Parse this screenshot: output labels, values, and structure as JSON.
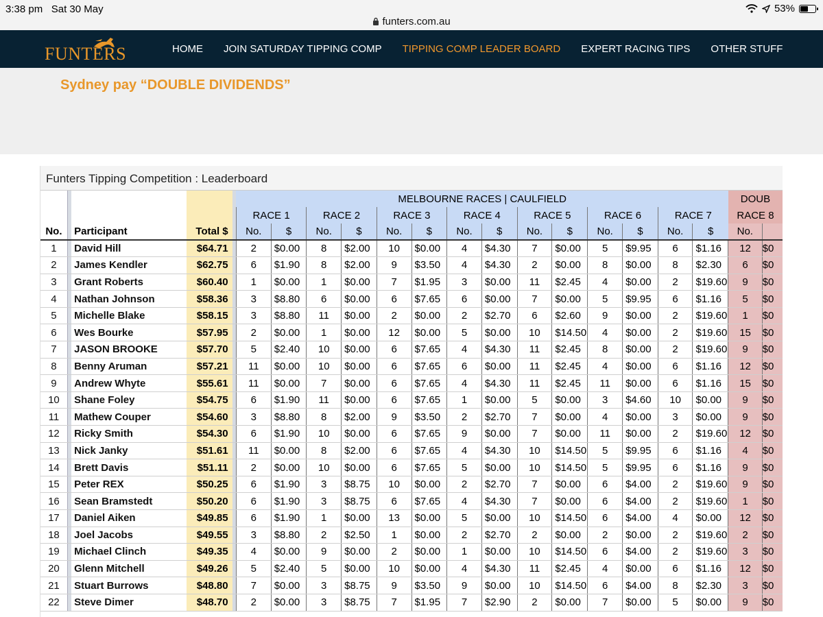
{
  "status": {
    "time": "3:38 pm",
    "date": "Sat 30 May",
    "url": "funters.com.au",
    "battery": "53%"
  },
  "nav": {
    "logo_text": "FUNTERS",
    "items": [
      {
        "label": "HOME",
        "active": false
      },
      {
        "label": "JOIN SATURDAY TIPPING COMP",
        "active": false
      },
      {
        "label": "TIPPING COMP LEADER BOARD",
        "active": true
      },
      {
        "label": "EXPERT RACING TIPS",
        "active": false
      },
      {
        "label": "OTHER STUFF",
        "active": false
      }
    ]
  },
  "banner": {
    "title": "Sydney pay “DOUBLE DIVIDENDS”"
  },
  "leaderboard": {
    "title": "Funters Tipping Competition : Leaderboard",
    "group_melbourne": "MELBOURNE RACES | CAULFIELD",
    "group_double": "DOUB",
    "races": [
      "RACE 1",
      "RACE 2",
      "RACE 3",
      "RACE 4",
      "RACE 5",
      "RACE 6",
      "RACE 7",
      "RACE 8"
    ],
    "col_no": "No.",
    "col_participant": "Participant",
    "col_total": "Total $",
    "sub_no": "No.",
    "sub_amt": "$",
    "rows": [
      {
        "rank": "1",
        "name": "David Hill",
        "total": "$64.71",
        "picks": [
          [
            "2",
            "$0.00"
          ],
          [
            "8",
            "$2.00"
          ],
          [
            "10",
            "$0.00"
          ],
          [
            "4",
            "$4.30"
          ],
          [
            "7",
            "$0.00"
          ],
          [
            "5",
            "$9.95"
          ],
          [
            "6",
            "$1.16"
          ]
        ],
        "d_no": "12",
        "d_amt": "$0"
      },
      {
        "rank": "2",
        "name": "James Kendler",
        "total": "$62.75",
        "picks": [
          [
            "6",
            "$1.90"
          ],
          [
            "8",
            "$2.00"
          ],
          [
            "9",
            "$3.50"
          ],
          [
            "4",
            "$4.30"
          ],
          [
            "2",
            "$0.00"
          ],
          [
            "8",
            "$0.00"
          ],
          [
            "8",
            "$2.30"
          ]
        ],
        "d_no": "6",
        "d_amt": "$0"
      },
      {
        "rank": "3",
        "name": "Grant Roberts",
        "total": "$60.40",
        "picks": [
          [
            "1",
            "$0.00"
          ],
          [
            "1",
            "$0.00"
          ],
          [
            "7",
            "$1.95"
          ],
          [
            "3",
            "$0.00"
          ],
          [
            "11",
            "$2.45"
          ],
          [
            "4",
            "$0.00"
          ],
          [
            "2",
            "$19.60"
          ]
        ],
        "d_no": "9",
        "d_amt": "$0"
      },
      {
        "rank": "4",
        "name": "Nathan Johnson",
        "total": "$58.36",
        "picks": [
          [
            "3",
            "$8.80"
          ],
          [
            "6",
            "$0.00"
          ],
          [
            "6",
            "$7.65"
          ],
          [
            "6",
            "$0.00"
          ],
          [
            "7",
            "$0.00"
          ],
          [
            "5",
            "$9.95"
          ],
          [
            "6",
            "$1.16"
          ]
        ],
        "d_no": "5",
        "d_amt": "$0"
      },
      {
        "rank": "5",
        "name": "Michelle Blake",
        "total": "$58.15",
        "picks": [
          [
            "3",
            "$8.80"
          ],
          [
            "11",
            "$0.00"
          ],
          [
            "2",
            "$0.00"
          ],
          [
            "2",
            "$2.70"
          ],
          [
            "6",
            "$2.60"
          ],
          [
            "9",
            "$0.00"
          ],
          [
            "2",
            "$19.60"
          ]
        ],
        "d_no": "1",
        "d_amt": "$0"
      },
      {
        "rank": "6",
        "name": "Wes Bourke",
        "total": "$57.95",
        "picks": [
          [
            "2",
            "$0.00"
          ],
          [
            "1",
            "$0.00"
          ],
          [
            "12",
            "$0.00"
          ],
          [
            "5",
            "$0.00"
          ],
          [
            "10",
            "$14.50"
          ],
          [
            "4",
            "$0.00"
          ],
          [
            "2",
            "$19.60"
          ]
        ],
        "d_no": "15",
        "d_amt": "$0"
      },
      {
        "rank": "7",
        "name": "JASON BROOKE",
        "total": "$57.70",
        "picks": [
          [
            "5",
            "$2.40"
          ],
          [
            "10",
            "$0.00"
          ],
          [
            "6",
            "$7.65"
          ],
          [
            "4",
            "$4.30"
          ],
          [
            "11",
            "$2.45"
          ],
          [
            "8",
            "$0.00"
          ],
          [
            "2",
            "$19.60"
          ]
        ],
        "d_no": "9",
        "d_amt": "$0"
      },
      {
        "rank": "8",
        "name": "Benny Aruman",
        "total": "$57.21",
        "picks": [
          [
            "11",
            "$0.00"
          ],
          [
            "10",
            "$0.00"
          ],
          [
            "6",
            "$7.65"
          ],
          [
            "6",
            "$0.00"
          ],
          [
            "11",
            "$2.45"
          ],
          [
            "4",
            "$0.00"
          ],
          [
            "6",
            "$1.16"
          ]
        ],
        "d_no": "12",
        "d_amt": "$0"
      },
      {
        "rank": "9",
        "name": "Andrew Whyte",
        "total": "$55.61",
        "picks": [
          [
            "11",
            "$0.00"
          ],
          [
            "7",
            "$0.00"
          ],
          [
            "6",
            "$7.65"
          ],
          [
            "4",
            "$4.30"
          ],
          [
            "11",
            "$2.45"
          ],
          [
            "11",
            "$0.00"
          ],
          [
            "6",
            "$1.16"
          ]
        ],
        "d_no": "15",
        "d_amt": "$0"
      },
      {
        "rank": "10",
        "name": "Shane Foley",
        "total": "$54.75",
        "picks": [
          [
            "6",
            "$1.90"
          ],
          [
            "11",
            "$0.00"
          ],
          [
            "6",
            "$7.65"
          ],
          [
            "1",
            "$0.00"
          ],
          [
            "5",
            "$0.00"
          ],
          [
            "3",
            "$4.60"
          ],
          [
            "10",
            "$0.00"
          ]
        ],
        "d_no": "9",
        "d_amt": "$0"
      },
      {
        "rank": "11",
        "name": "Mathew Couper",
        "total": "$54.60",
        "picks": [
          [
            "3",
            "$8.80"
          ],
          [
            "8",
            "$2.00"
          ],
          [
            "9",
            "$3.50"
          ],
          [
            "2",
            "$2.70"
          ],
          [
            "7",
            "$0.00"
          ],
          [
            "4",
            "$0.00"
          ],
          [
            "3",
            "$0.00"
          ]
        ],
        "d_no": "9",
        "d_amt": "$0"
      },
      {
        "rank": "12",
        "name": "Ricky Smith",
        "total": "$54.30",
        "picks": [
          [
            "6",
            "$1.90"
          ],
          [
            "10",
            "$0.00"
          ],
          [
            "6",
            "$7.65"
          ],
          [
            "9",
            "$0.00"
          ],
          [
            "7",
            "$0.00"
          ],
          [
            "11",
            "$0.00"
          ],
          [
            "2",
            "$19.60"
          ]
        ],
        "d_no": "12",
        "d_amt": "$0"
      },
      {
        "rank": "13",
        "name": "Nick Janky",
        "total": "$51.61",
        "picks": [
          [
            "11",
            "$0.00"
          ],
          [
            "8",
            "$2.00"
          ],
          [
            "6",
            "$7.65"
          ],
          [
            "4",
            "$4.30"
          ],
          [
            "10",
            "$14.50"
          ],
          [
            "5",
            "$9.95"
          ],
          [
            "6",
            "$1.16"
          ]
        ],
        "d_no": "4",
        "d_amt": "$0"
      },
      {
        "rank": "14",
        "name": "Brett Davis",
        "total": "$51.11",
        "picks": [
          [
            "2",
            "$0.00"
          ],
          [
            "10",
            "$0.00"
          ],
          [
            "6",
            "$7.65"
          ],
          [
            "5",
            "$0.00"
          ],
          [
            "10",
            "$14.50"
          ],
          [
            "5",
            "$9.95"
          ],
          [
            "6",
            "$1.16"
          ]
        ],
        "d_no": "9",
        "d_amt": "$0"
      },
      {
        "rank": "15",
        "name": "Peter REX",
        "total": "$50.25",
        "picks": [
          [
            "6",
            "$1.90"
          ],
          [
            "3",
            "$8.75"
          ],
          [
            "10",
            "$0.00"
          ],
          [
            "2",
            "$2.70"
          ],
          [
            "7",
            "$0.00"
          ],
          [
            "6",
            "$4.00"
          ],
          [
            "2",
            "$19.60"
          ]
        ],
        "d_no": "9",
        "d_amt": "$0"
      },
      {
        "rank": "16",
        "name": "Sean Bramstedt",
        "total": "$50.20",
        "picks": [
          [
            "6",
            "$1.90"
          ],
          [
            "3",
            "$8.75"
          ],
          [
            "6",
            "$7.65"
          ],
          [
            "4",
            "$4.30"
          ],
          [
            "7",
            "$0.00"
          ],
          [
            "6",
            "$4.00"
          ],
          [
            "2",
            "$19.60"
          ]
        ],
        "d_no": "1",
        "d_amt": "$0"
      },
      {
        "rank": "17",
        "name": "Daniel Aiken",
        "total": "$49.85",
        "picks": [
          [
            "6",
            "$1.90"
          ],
          [
            "1",
            "$0.00"
          ],
          [
            "13",
            "$0.00"
          ],
          [
            "5",
            "$0.00"
          ],
          [
            "10",
            "$14.50"
          ],
          [
            "6",
            "$4.00"
          ],
          [
            "4",
            "$0.00"
          ]
        ],
        "d_no": "12",
        "d_amt": "$0"
      },
      {
        "rank": "18",
        "name": "Joel Jacobs",
        "total": "$49.55",
        "picks": [
          [
            "3",
            "$8.80"
          ],
          [
            "2",
            "$2.50"
          ],
          [
            "1",
            "$0.00"
          ],
          [
            "2",
            "$2.70"
          ],
          [
            "2",
            "$0.00"
          ],
          [
            "2",
            "$0.00"
          ],
          [
            "2",
            "$19.60"
          ]
        ],
        "d_no": "2",
        "d_amt": "$0"
      },
      {
        "rank": "19",
        "name": "Michael Clinch",
        "total": "$49.35",
        "picks": [
          [
            "4",
            "$0.00"
          ],
          [
            "9",
            "$0.00"
          ],
          [
            "2",
            "$0.00"
          ],
          [
            "1",
            "$0.00"
          ],
          [
            "10",
            "$14.50"
          ],
          [
            "6",
            "$4.00"
          ],
          [
            "2",
            "$19.60"
          ]
        ],
        "d_no": "3",
        "d_amt": "$0"
      },
      {
        "rank": "20",
        "name": "Glenn Mitchell",
        "total": "$49.26",
        "picks": [
          [
            "5",
            "$2.40"
          ],
          [
            "5",
            "$0.00"
          ],
          [
            "10",
            "$0.00"
          ],
          [
            "4",
            "$4.30"
          ],
          [
            "11",
            "$2.45"
          ],
          [
            "4",
            "$0.00"
          ],
          [
            "6",
            "$1.16"
          ]
        ],
        "d_no": "12",
        "d_amt": "$0"
      },
      {
        "rank": "21",
        "name": "Stuart Burrows",
        "total": "$48.80",
        "picks": [
          [
            "7",
            "$0.00"
          ],
          [
            "3",
            "$8.75"
          ],
          [
            "9",
            "$3.50"
          ],
          [
            "9",
            "$0.00"
          ],
          [
            "10",
            "$14.50"
          ],
          [
            "6",
            "$4.00"
          ],
          [
            "8",
            "$2.30"
          ]
        ],
        "d_no": "3",
        "d_amt": "$0"
      },
      {
        "rank": "22",
        "name": "Steve Dimer",
        "total": "$48.70",
        "picks": [
          [
            "2",
            "$0.00"
          ],
          [
            "3",
            "$8.75"
          ],
          [
            "7",
            "$1.95"
          ],
          [
            "7",
            "$2.90"
          ],
          [
            "2",
            "$0.00"
          ],
          [
            "7",
            "$0.00"
          ],
          [
            "5",
            "$0.00"
          ]
        ],
        "d_no": "9",
        "d_amt": "$0"
      }
    ]
  },
  "colors": {
    "nav_bg": "#082233",
    "accent": "#f0972d",
    "melbourne_header": "#c8daf5",
    "double_header": "#e3b3b0",
    "total_bg": "#fbecb9"
  }
}
